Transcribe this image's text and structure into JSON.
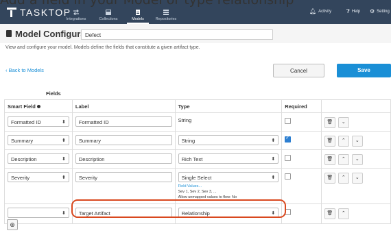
{
  "caption": "Add a field in your Model or type relationship",
  "topbar": {
    "logo": "TASKTOP",
    "nav": [
      {
        "label": "Integrations",
        "icon": "integrations-icon"
      },
      {
        "label": "Collections",
        "icon": "collections-icon"
      },
      {
        "label": "Models",
        "icon": "models-icon"
      },
      {
        "label": "Repositories",
        "icon": "repositories-icon"
      }
    ],
    "active_nav": "Models",
    "right": [
      {
        "label": "Activity",
        "icon": "bell-icon"
      },
      {
        "label": "Help",
        "icon": "help-icon"
      },
      {
        "label": "Setting",
        "icon": "gear-icon"
      }
    ]
  },
  "header": {
    "title": "Model Configuration",
    "model_name": "Defect",
    "subtitle": "View and configure your model. Models define the fields that constitute a given artifact type."
  },
  "toolbar": {
    "back": "Back to Models",
    "cancel": "Cancel",
    "save": "Save"
  },
  "table": {
    "section_title": "Fields",
    "columns": {
      "smart_field": "Smart Field",
      "label": "Label",
      "type": "Type",
      "required": "Required"
    },
    "rows": [
      {
        "smart_field": "Formatted ID",
        "label": "Formatted ID",
        "type": "String",
        "required": false
      },
      {
        "smart_field": "Summary",
        "label": "Summary",
        "type": "String",
        "required": true
      },
      {
        "smart_field": "Description",
        "label": "Description",
        "type": "Rich Text",
        "required": false
      },
      {
        "smart_field": "Severity",
        "label": "Severity",
        "type": "Single Select",
        "required": false,
        "field_values_link": "Field Values...",
        "field_values": "Sev 1, Sev 2, Sev 3, ...",
        "flow_note": "Allow unmapped values to flow: No"
      },
      {
        "smart_field": "",
        "label": "Target Artifact",
        "type": "Relationship",
        "required": false
      }
    ]
  },
  "colors": {
    "topbar": "#33455c",
    "accent": "#1a8fd6",
    "highlight": "#d9481e"
  }
}
